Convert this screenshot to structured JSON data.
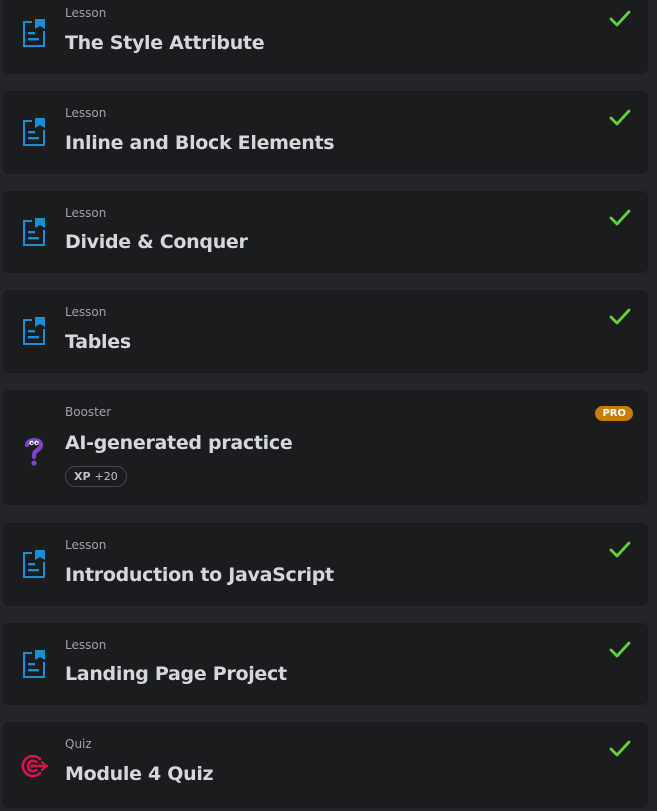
{
  "lessons": [
    {
      "type": "Lesson",
      "title": "The Style Attribute",
      "completed": true,
      "icon": "lesson-document-icon"
    },
    {
      "type": "Lesson",
      "title": "Inline and Block Elements",
      "completed": true,
      "icon": "lesson-document-icon"
    },
    {
      "type": "Lesson",
      "title": "Divide & Conquer",
      "completed": true,
      "icon": "lesson-document-icon"
    },
    {
      "type": "Lesson",
      "title": "Tables",
      "completed": true,
      "icon": "lesson-document-icon"
    },
    {
      "type": "Booster",
      "title": "AI-generated practice",
      "badge": "PRO",
      "xp_label": "XP",
      "xp_value": "+20",
      "icon": "question-mark-icon"
    },
    {
      "type": "Lesson",
      "title": "Introduction to JavaScript",
      "completed": true,
      "icon": "lesson-document-icon"
    },
    {
      "type": "Lesson",
      "title": "Landing Page Project",
      "completed": true,
      "icon": "lesson-document-icon"
    },
    {
      "type": "Quiz",
      "title": "Module 4 Quiz",
      "completed": true,
      "icon": "target-icon"
    }
  ],
  "colors": {
    "background": "#232528",
    "card": "#1b1c1e",
    "lesson_icon": "#1b8fd6",
    "check": "#5fd13c",
    "pro_badge": "#c77d0a",
    "quiz_icon": "#e0104a",
    "booster_icon": "#7b45c9"
  }
}
